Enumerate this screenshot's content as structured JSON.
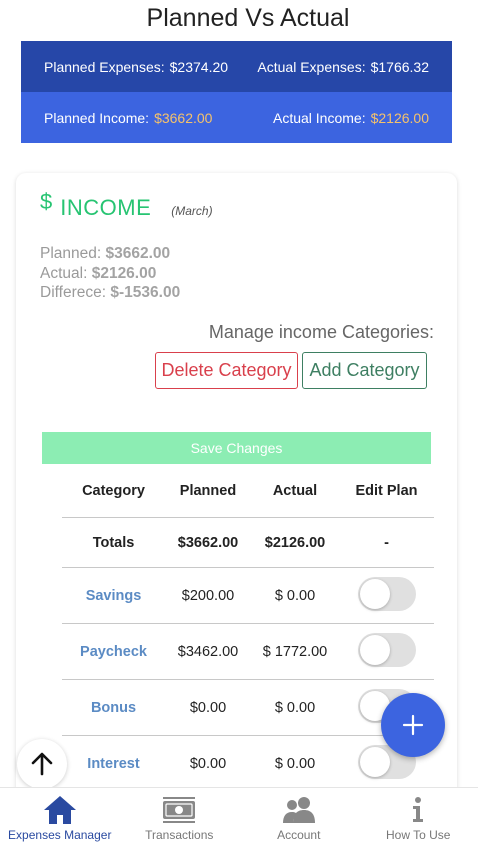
{
  "page_title": "Planned Vs Actual",
  "summary": {
    "planned_expenses_label": "Planned Expenses:",
    "planned_expenses_value": "$2374.20",
    "actual_expenses_label": "Actual Expenses:",
    "actual_expenses_value": "$1766.32",
    "planned_income_label": "Planned Income:",
    "planned_income_value": "$3662.00",
    "actual_income_label": "Actual Income:",
    "actual_income_value": "$2126.00"
  },
  "income_card": {
    "dollar_symbol": "$",
    "title": "INCOME",
    "month": "(March)",
    "planned_label": "Planned:",
    "planned_value": "$3662.00",
    "actual_label": "Actual:",
    "actual_value": "$2126.00",
    "difference_label": "Differece:",
    "difference_value": "$-1536.00",
    "manage_label": "Manage income Categories:",
    "delete_button": "Delete Category",
    "add_button": "Add Category",
    "save_button": "Save Changes"
  },
  "table": {
    "headers": [
      "Category",
      "Planned",
      "Actual",
      "Edit Plan"
    ],
    "totals": {
      "label": "Totals",
      "planned": "$3662.00",
      "actual": "$2126.00",
      "edit": "-"
    },
    "rows": [
      {
        "category": "Savings",
        "planned": "$200.00",
        "actual": "$ 0.00",
        "edit_plan_on": false
      },
      {
        "category": "Paycheck",
        "planned": "$3462.00",
        "actual": "$ 1772.00",
        "edit_plan_on": false
      },
      {
        "category": "Bonus",
        "planned": "$0.00",
        "actual": "$ 0.00",
        "edit_plan_on": false
      },
      {
        "category": "Interest",
        "planned": "$0.00",
        "actual": "$ 0.00",
        "edit_plan_on": false
      }
    ]
  },
  "fab": {
    "add_icon": "plus-icon",
    "scroll_top_icon": "arrow-up-icon"
  },
  "bottom_nav": {
    "items": [
      {
        "label": "Expenses Manager",
        "icon": "home-icon",
        "active": true
      },
      {
        "label": "Transactions",
        "icon": "money-icon",
        "active": false
      },
      {
        "label": "Account",
        "icon": "users-icon",
        "active": false
      },
      {
        "label": "How To Use",
        "icon": "info-icon",
        "active": false
      }
    ]
  },
  "colors": {
    "summary_dark": "#2647a8",
    "summary_light": "#3c64e0",
    "income_green": "#27c472",
    "delete_red": "#d9404c",
    "add_green": "#3e7f62",
    "save_green": "#8cedb3",
    "category_blue": "#5b8bc4",
    "gold_value": "#f5c26b",
    "nav_active": "#2a4aa0"
  }
}
